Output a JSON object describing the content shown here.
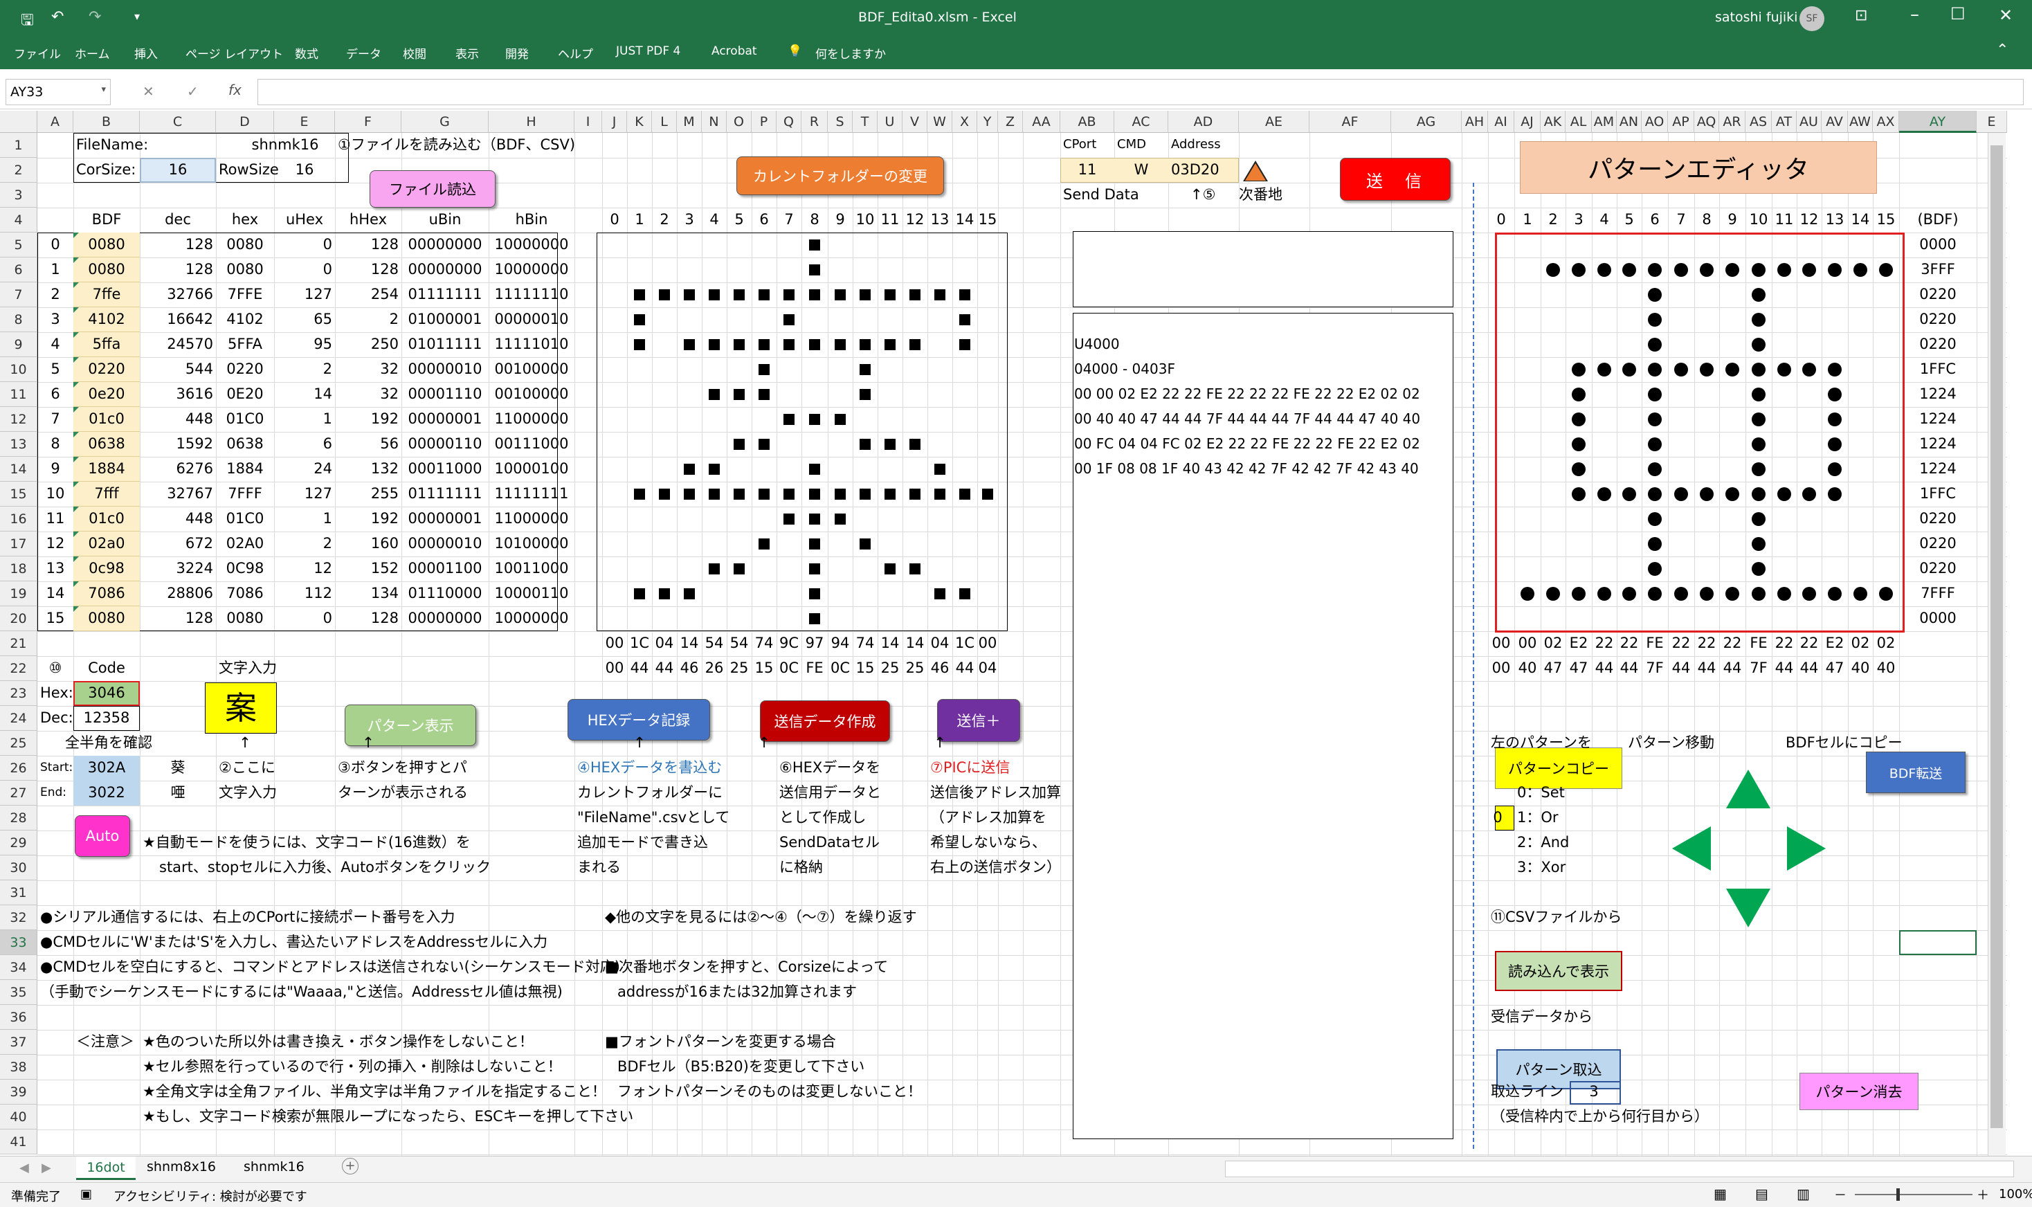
{
  "window": {
    "title": "BDF_Edita0.xlsm  -  Excel",
    "user": "satoshi fujiki",
    "user_initials": "SF"
  },
  "ribbon_tabs": [
    "ファイル",
    "ホーム",
    "挿入",
    "ページ レイアウト",
    "数式",
    "データ",
    "校閲",
    "表示",
    "開発",
    "ヘルプ",
    "JUST PDF 4",
    "Acrobat"
  ],
  "tell_me": "何をしますか",
  "name_box": "AY33",
  "fx": "fx",
  "columns": [
    "A",
    "B",
    "C",
    "D",
    "E",
    "F",
    "G",
    "H",
    "I",
    "J",
    "K",
    "L",
    "M",
    "N",
    "O",
    "P",
    "Q",
    "R",
    "S",
    "T",
    "U",
    "V",
    "W",
    "X",
    "Y",
    "Z",
    "AA",
    "AB",
    "AC",
    "AD",
    "AE",
    "AF",
    "AG",
    "AH",
    "AI",
    "AJ",
    "AK",
    "AL",
    "AM",
    "AN",
    "AO",
    "AP",
    "AQ",
    "AR",
    "AS",
    "AT",
    "AU",
    "AV",
    "AW",
    "AX",
    "AY",
    "E"
  ],
  "rows": [
    "1",
    "2",
    "3",
    "4",
    "5",
    "6",
    "7",
    "8",
    "9",
    "10",
    "11",
    "12",
    "13",
    "14",
    "15",
    "16",
    "17",
    "18",
    "19",
    "20",
    "21",
    "22",
    "23",
    "24",
    "25",
    "26",
    "27",
    "28",
    "29",
    "30",
    "31",
    "32",
    "33",
    "34",
    "35",
    "36",
    "37",
    "38",
    "39",
    "40",
    "41"
  ],
  "header": {
    "filename_label": "FileName:",
    "filename": "shnmk16",
    "corsize_label": "CorSize:",
    "corsize": "16",
    "rowsize_label": "RowSize",
    "rowsize": "16",
    "read_note": "①ファイルを読み込む（BDF、CSV)"
  },
  "buttons": {
    "file_read": "ファイル読込",
    "change_folder": "カレントフォルダーの変更",
    "send": "送　信",
    "pattern_editor": "パターンエディッタ",
    "pattern_show": "パターン表示",
    "hex_record": "HEXデータ記録",
    "send_data_make": "送信データ作成",
    "send_plus": "送信＋",
    "auto": "Auto",
    "pattern_copy": "パターンコピー",
    "bdf_transfer": "BDF転送",
    "read_show": "読み込んで表示",
    "pattern_import": "パターン取込",
    "pattern_clear": "パターン消去"
  },
  "table_headers": [
    "BDF",
    "dec",
    "hex",
    "uHex",
    "hHex",
    "uBin",
    "hBin"
  ],
  "table_rows": [
    [
      "0",
      "0080",
      "128",
      "0080",
      "0",
      "128",
      "00000000",
      "10000000"
    ],
    [
      "1",
      "0080",
      "128",
      "0080",
      "0",
      "128",
      "00000000",
      "10000000"
    ],
    [
      "2",
      "7ffe",
      "32766",
      "7FFE",
      "127",
      "254",
      "01111111",
      "11111110"
    ],
    [
      "3",
      "4102",
      "16642",
      "4102",
      "65",
      "2",
      "01000001",
      "00000010"
    ],
    [
      "4",
      "5ffa",
      "24570",
      "5FFA",
      "95",
      "250",
      "01011111",
      "11111010"
    ],
    [
      "5",
      "0220",
      "544",
      "0220",
      "2",
      "32",
      "00000010",
      "00100000"
    ],
    [
      "6",
      "0e20",
      "3616",
      "0E20",
      "14",
      "32",
      "00001110",
      "00100000"
    ],
    [
      "7",
      "01c0",
      "448",
      "01C0",
      "1",
      "192",
      "00000001",
      "11000000"
    ],
    [
      "8",
      "0638",
      "1592",
      "0638",
      "6",
      "56",
      "00000110",
      "00111000"
    ],
    [
      "9",
      "1884",
      "6276",
      "1884",
      "24",
      "132",
      "00011000",
      "10000100"
    ],
    [
      "10",
      "7fff",
      "32767",
      "7FFF",
      "127",
      "255",
      "01111111",
      "11111111"
    ],
    [
      "11",
      "01c0",
      "448",
      "01C0",
      "1",
      "192",
      "00000001",
      "11000000"
    ],
    [
      "12",
      "02a0",
      "672",
      "02A0",
      "2",
      "160",
      "00000010",
      "10100000"
    ],
    [
      "13",
      "0c98",
      "3224",
      "0C98",
      "12",
      "152",
      "00001100",
      "10011000"
    ],
    [
      "14",
      "7086",
      "28806",
      "7086",
      "112",
      "134",
      "01110000",
      "10000110"
    ],
    [
      "15",
      "0080",
      "128",
      "0080",
      "0",
      "128",
      "00000000",
      "10000000"
    ]
  ],
  "grid_col_index": [
    "0",
    "1",
    "2",
    "3",
    "4",
    "5",
    "6",
    "7",
    "8",
    "9",
    "10",
    "11",
    "12",
    "13",
    "14",
    "15"
  ],
  "bitmap_left": [
    "0080",
    "0080",
    "7ffe",
    "4102",
    "5ffa",
    "0220",
    "0e20",
    "01c0",
    "0638",
    "1884",
    "7fff",
    "01c0",
    "02a0",
    "0c98",
    "7086",
    "0080"
  ],
  "bitmap_right": [
    "0000",
    "3FFF",
    "0220",
    "0220",
    "0220",
    "1FFC",
    "1224",
    "1224",
    "1224",
    "1224",
    "1FFC",
    "0220",
    "0220",
    "0220",
    "7FFF",
    "0000"
  ],
  "left_row21": [
    "00",
    "1C",
    "04",
    "14",
    "54",
    "54",
    "74",
    "9C",
    "97",
    "94",
    "74",
    "14",
    "14",
    "04",
    "1C",
    "00"
  ],
  "left_row22": [
    "00",
    "44",
    "44",
    "46",
    "26",
    "25",
    "15",
    "0C",
    "FE",
    "0C",
    "15",
    "25",
    "25",
    "46",
    "44",
    "04"
  ],
  "right_row21": [
    "00",
    "00",
    "02",
    "E2",
    "22",
    "22",
    "FE",
    "22",
    "22",
    "22",
    "FE",
    "22",
    "22",
    "E2",
    "02",
    "02"
  ],
  "right_row22": [
    "00",
    "40",
    "47",
    "47",
    "44",
    "44",
    "7F",
    "44",
    "44",
    "44",
    "7F",
    "44",
    "44",
    "47",
    "40",
    "40"
  ],
  "right_bdf_label": "(BDF)",
  "send_panel": {
    "cport_label": "CPort",
    "cmd_label": "CMD",
    "address_label": "Address",
    "cport": "11",
    "cmd": "W",
    "address": "03D20",
    "send_data_label": "Send Data",
    "step5": "↑⑤",
    "next_addr": "次番地",
    "lines": [
      "U4000",
      "04000 - 0403F",
      "00 00 02 E2 22 22 FE 22 22 22 FE 22 22 E2 02 02",
      "00 40 40 47 44 44 7F 44 44 44 7F 44 44 47 40 40",
      "00 FC 04 04 FC 02 E2 22 22 FE 22 22 FE 22 E2 02",
      "00 1F 08 08 1F 40 43 42 42 7F 42 42 7F 42 43 40"
    ]
  },
  "code_area": {
    "label10": "⑩",
    "code_label": "Code",
    "moji_label": "文字入力",
    "hex_label": "Hex:",
    "hex": "3046",
    "dec_label": "Dec:",
    "dec": "12358",
    "char": "案",
    "check_label": "全半角を確認",
    "start_label": "Start:",
    "start": "302A",
    "start_char": "葵",
    "end_label": "End:",
    "end": "3022",
    "end_char": "唖",
    "arrow": "↑"
  },
  "notes": {
    "n2a": "②ここに",
    "n2b": "文字入力",
    "n3a": "③ボタンを押すとパ",
    "n3b": "ターンが表示される",
    "n4a": "④HEXデータを書込む",
    "n4b": "カレントフォルダーに",
    "n4c": "\"FileName\".csvとして",
    "n4d": "追加モードで書き込",
    "n4e": "まれる",
    "n6a": "⑥HEXデータを",
    "n6b": "送信用データと",
    "n6c": "として作成し",
    "n6d": "SendDataセル",
    "n6e": "に格納",
    "n7a": "⑦PICに送信",
    "n7b": "送信後アドレス加算",
    "n7c": "（アドレス加算を",
    "n7d": "希望しないなら、",
    "n7e": "右上の送信ボタン）",
    "auto1": "★自動モードを使うには、文字コード(16進数）を",
    "auto2": "start、stopセルに入力後、Autoボタンをクリック",
    "l32": "●シリアル通信するには、右上のCPortに接続ポート番号を入力",
    "l33": "●CMDセルに'W'または'S'を入力し、書込たいアドレスをAddressセルに入力",
    "l34": "●CMDセルを空白にすると、コマンドとアドレスは送信されない(シーケンスモード対応)",
    "l35": "（手動でシーケンスモードにするには\"Waaaa,\"と送信。Addressセル値は無視)",
    "caution": "＜注意＞",
    "c37": "★色のついた所以外は書き換え・ボタン操作をしないこと！",
    "c38": "★セル参照を行っているので行・列の挿入・削除はしないこと！",
    "c39": "★全角文字は全角ファイル、半角文字は半角ファイルを指定すること！",
    "c40": "★もし、文字コード検索が無限ループになったら、ESCキーを押して下さい",
    "m32": "◆他の文字を見るには②～④（～⑦）を繰り返す",
    "m34": "■次番地ボタンを押すと、Corsizeによって",
    "m35": "addressが16または32加算されます",
    "m37": "■フォントパターンを変更する場合",
    "m38": "BDFセル（B5:B20)を変更して下さい",
    "m39": "フォントパターンそのものは変更しないこと！"
  },
  "editor_panel": {
    "left_pattern": "左のパターンを",
    "pattern_move": "パターン移動",
    "bdf_copy": "BDFセルにコピー",
    "mode_value": "0",
    "modes": [
      "0：Set",
      "1：Or",
      "2：And",
      "3：Xor"
    ],
    "csv_from": "⑪CSVファイルから",
    "recv_from": "受信データから",
    "import_line_label": "取込ライン",
    "import_line": "3",
    "import_note": "（受信枠内で上から何行目から）"
  },
  "sheets": [
    "16dot",
    "shnm8x16",
    "shnmk16"
  ],
  "status": {
    "ready": "準備完了",
    "accessibility": "アクセシビリティ: 検討が必要です",
    "zoom": "100%"
  }
}
